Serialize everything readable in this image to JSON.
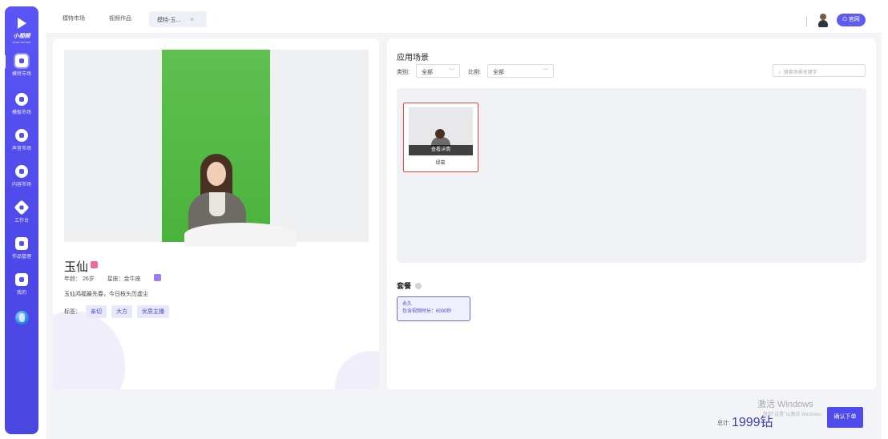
{
  "sidebar": {
    "logo_text": "小视频",
    "logo_sub": "short vid hub",
    "items": [
      {
        "label": "模特市场",
        "icon": "person-icon",
        "active": true
      },
      {
        "label": "模板市场",
        "icon": "template-icon",
        "active": false
      },
      {
        "label": "声音市场",
        "icon": "sound-icon",
        "active": false
      },
      {
        "label": "内容市场",
        "icon": "content-icon",
        "active": false
      },
      {
        "label": "工作台",
        "icon": "workbench-icon",
        "active": false
      },
      {
        "label": "作品管理",
        "icon": "works-icon",
        "active": false
      },
      {
        "label": "我的",
        "icon": "user-icon",
        "active": false
      }
    ]
  },
  "tabs": [
    {
      "label": "模特市场"
    },
    {
      "label": "视频作品"
    },
    {
      "label": "模特-玉...",
      "close": "×"
    }
  ],
  "header": {
    "official_label": "⏻ 官网"
  },
  "model": {
    "name": "玉仙",
    "age": "年龄： 26岁",
    "constellation": "星座：金牛座",
    "description": "玉仙鸿福最先春，今日枝头历虚尘",
    "tags_label": "标签：",
    "tags": [
      "亲切",
      "大方",
      "优质主播"
    ]
  },
  "scenes": {
    "title": "应用场景",
    "category_label": "类别:",
    "category_value": "全部",
    "ratio_label": "比例:",
    "ratio_value": "全部",
    "search_placeholder": "搜索场景关键字",
    "items": [
      {
        "overlay": "查看详情",
        "name": "绿幕"
      }
    ]
  },
  "package": {
    "title": "套餐",
    "items": [
      {
        "name": "永久",
        "detail": "包含视频时长：6000秒"
      }
    ]
  },
  "footer": {
    "total_label": "总计:",
    "total_amount": "1999钻",
    "confirm_label": "确认下单"
  },
  "watermark": {
    "line1": "激活 Windows",
    "line2": "转到\"设置\"以激活 Windows。"
  },
  "colors": {
    "accent": "#4f4bed",
    "sidebar": "#5a55f5",
    "selected_border": "#e5483d",
    "green_screen": "#4ab33c"
  }
}
